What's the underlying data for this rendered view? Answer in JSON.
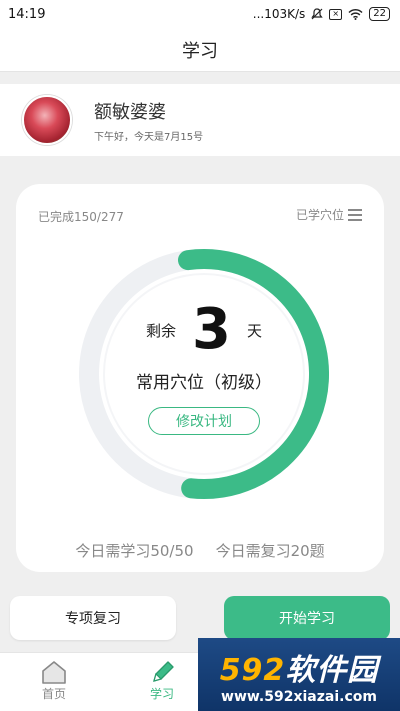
{
  "status_bar": {
    "time": "14:19",
    "speed": "...103K/s",
    "battery": "22",
    "sim_icon_char": "×"
  },
  "header": {
    "title": "学习"
  },
  "profile": {
    "name": "额敏婆婆",
    "greeting": "下午好，今天是7月15号"
  },
  "plan": {
    "completed": "已完成150/277",
    "learned_label": "已学穴位",
    "remaining_prefix": "剩余",
    "remaining_days": "3",
    "days_unit": "天",
    "category": "常用穴位（初级）",
    "modify_button": "修改计划",
    "progress_fraction": 0.54,
    "today_study": "今日需学习50/50",
    "today_review": "今日需复习20题"
  },
  "actions": {
    "review_button": "专项复习",
    "start_button": "开始学习"
  },
  "tabs": [
    {
      "label": "首页"
    },
    {
      "label": "学习"
    }
  ],
  "watermark": {
    "number": "592",
    "brand": "软件园",
    "url": "www.592xiazai.com"
  },
  "colors": {
    "accent": "#3cbb88",
    "ring_track": "#eef0f3"
  }
}
